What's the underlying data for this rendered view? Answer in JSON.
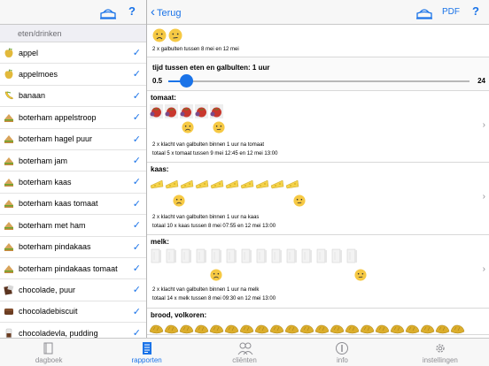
{
  "left_panel": {
    "section_header": "eten/drinken",
    "items": [
      {
        "label": "appel",
        "checked": true,
        "icon": "apple-icon"
      },
      {
        "label": "appelmoes",
        "checked": true,
        "icon": "apple-icon"
      },
      {
        "label": "banaan",
        "checked": true,
        "icon": "banana-icon"
      },
      {
        "label": "boterham appelstroop",
        "checked": true,
        "icon": "sandwich-icon"
      },
      {
        "label": "boterham hagel puur",
        "checked": true,
        "icon": "sandwich-icon"
      },
      {
        "label": "boterham jam",
        "checked": true,
        "icon": "sandwich-icon"
      },
      {
        "label": "boterham kaas",
        "checked": true,
        "icon": "sandwich-icon"
      },
      {
        "label": "boterham kaas tomaat",
        "checked": true,
        "icon": "sandwich-icon"
      },
      {
        "label": "boterham met ham",
        "checked": true,
        "icon": "sandwich-icon"
      },
      {
        "label": "boterham pindakaas",
        "checked": true,
        "icon": "sandwich-icon"
      },
      {
        "label": "boterham pindakaas tomaat",
        "checked": true,
        "icon": "sandwich-icon"
      },
      {
        "label": "chocolade, puur",
        "checked": true,
        "icon": "chocolate-icon"
      },
      {
        "label": "chocoladebiscuit",
        "checked": true,
        "icon": "biscuit-icon"
      },
      {
        "label": "chocoladevla, pudding",
        "checked": true,
        "icon": "pudding-icon"
      }
    ],
    "help_label": "?"
  },
  "right_panel": {
    "back_label": "Terug",
    "pdf_label": "PDF",
    "help_label": "?",
    "summary_text": "2 x galbulten tussen 8 mei en 12 mei",
    "slider": {
      "title": "tijd tussen eten en galbulten: 1 uur",
      "min_label": "0.5",
      "max_label": "24",
      "value_fraction": 0.06
    },
    "cards": [
      {
        "title": "tomaat:",
        "line1": "2 x  klacht van galbulten binnen 1 uur na tomaat",
        "line2": "totaal 5 x tomaat tussen 9 mei 12:45 en 12 mei 13:00",
        "icon_count": 5,
        "icon": "tomato-icon"
      },
      {
        "title": "kaas:",
        "line1": "2 x  klacht van galbulten binnen 1 uur na kaas",
        "line2": "totaal 10 x kaas tussen 8 mei 07:55 en 12 mei 13:00",
        "icon_count": 10,
        "icon": "cheese-icon"
      },
      {
        "title": "melk:",
        "line1": "2 x  klacht van galbulten binnen 1 uur na melk",
        "line2": "totaal 14 x melk tussen 8 mei 09:30 en 12 mei 13:00",
        "icon_count": 14,
        "icon": "milk-icon"
      },
      {
        "title": "brood, volkoren:",
        "icon_count": 21,
        "icon": "bread-icon"
      }
    ]
  },
  "tabbar": {
    "tabs": [
      {
        "label": "dagboek",
        "icon": "book-icon",
        "active": false
      },
      {
        "label": "rapporten",
        "icon": "report-icon",
        "active": true
      },
      {
        "label": "cliënten",
        "icon": "people-icon",
        "active": false
      },
      {
        "label": "info",
        "icon": "info-icon",
        "active": false
      },
      {
        "label": "instellingen",
        "icon": "gear-icon",
        "active": false
      }
    ]
  },
  "colors": {
    "accent": "#1a73e8",
    "face_yellow": "#f6c944",
    "tomato_red": "#c8372d",
    "cheese_yellow": "#f5d34a"
  }
}
